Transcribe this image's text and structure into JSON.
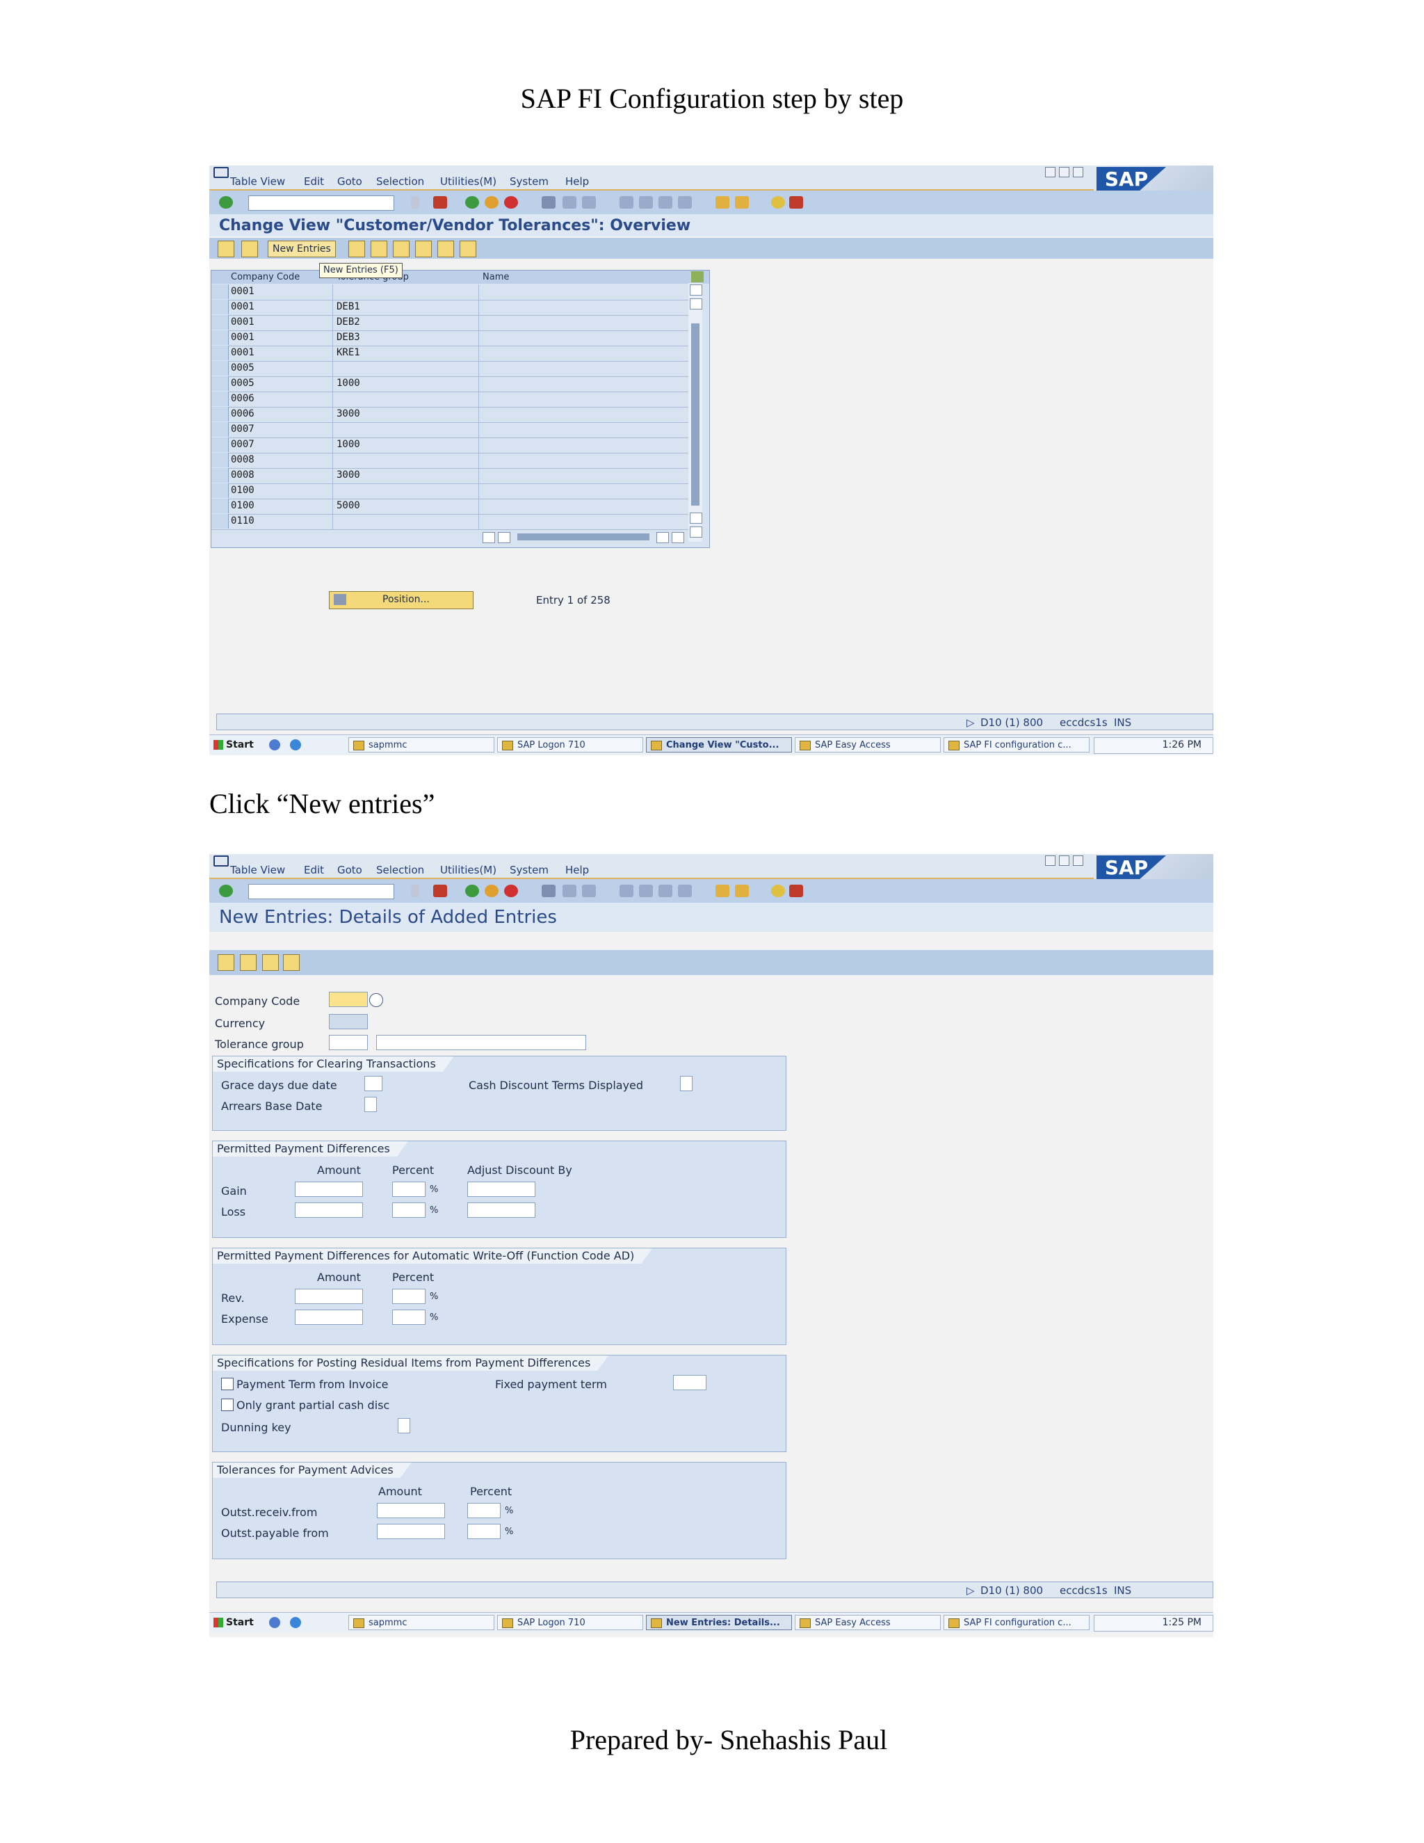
{
  "document": {
    "title": "SAP FI Configuration step by step",
    "caption": "Click “New entries”",
    "footer": "Prepared by- Snehashis Paul"
  },
  "colors": {
    "sap_blue": "#1f56a8",
    "toolbar_blue": "#bcd0ea",
    "title_blue": "#2b4a8a",
    "required_yellow": "#fbe38e"
  },
  "menu": [
    "Table View",
    "Edit",
    "Goto",
    "Selection",
    "Utilities(M)",
    "System",
    "Help"
  ],
  "sap_logo": "SAP",
  "screen1": {
    "title": "Change View \"Customer/Vendor Tolerances\": Overview",
    "new_entries_label": "New Entries",
    "tooltip": "New Entries   (F5)",
    "columns": [
      "Company Code",
      "Tolerance group",
      "Name"
    ],
    "rows": [
      [
        "0001",
        ""
      ],
      [
        "0001",
        "DEB1"
      ],
      [
        "0001",
        "DEB2"
      ],
      [
        "0001",
        "DEB3"
      ],
      [
        "0001",
        "KRE1"
      ],
      [
        "0005",
        ""
      ],
      [
        "0005",
        "1000"
      ],
      [
        "0006",
        ""
      ],
      [
        "0006",
        "3000"
      ],
      [
        "0007",
        ""
      ],
      [
        "0007",
        "1000"
      ],
      [
        "0008",
        ""
      ],
      [
        "0008",
        "3000"
      ],
      [
        "0100",
        ""
      ],
      [
        "0100",
        "5000"
      ],
      [
        "0110",
        ""
      ]
    ],
    "position_label": "Position...",
    "entry_info": "Entry 1 of 258",
    "status": {
      "system": "D10 (1) 800",
      "server": "eccdcs1s",
      "mode": "INS"
    },
    "taskbar": {
      "start": "Start",
      "tasks": [
        "sapmmc",
        "SAP Logon 710",
        "Change View \"Custo...",
        "SAP Easy Access",
        "SAP FI configuration c..."
      ],
      "active_index": 2,
      "clock": "1:26 PM"
    }
  },
  "screen2": {
    "title": "New Entries: Details of Added Entries",
    "fields": {
      "company_code": "Company Code",
      "currency": "Currency",
      "tolerance_group": "Tolerance group"
    },
    "clearing": {
      "title": "Specifications for Clearing Transactions",
      "grace_days": "Grace days due date",
      "arrears_base": "Arrears Base Date",
      "cash_discount": "Cash Discount Terms Displayed"
    },
    "payment_diff": {
      "title": "Permitted Payment Differences",
      "col_amount": "Amount",
      "col_percent": "Percent",
      "col_adjust": "Adjust Discount By",
      "gain": "Gain",
      "loss": "Loss"
    },
    "auto_writeoff": {
      "title": "Permitted Payment Differences for Automatic Write-Off (Function Code AD)",
      "col_amount": "Amount",
      "col_percent": "Percent",
      "rev": "Rev.",
      "expense": "Expense"
    },
    "residual": {
      "title": "Specifications for Posting Residual Items from Payment Differences",
      "payment_term": "Payment Term from Invoice",
      "partial_cash": "Only grant partial cash disc",
      "dunning_key": "Dunning key",
      "fixed_term": "Fixed payment term"
    },
    "advices": {
      "title": "Tolerances for Payment Advices",
      "col_amount": "Amount",
      "col_percent": "Percent",
      "outst_receiv": "Outst.receiv.from",
      "outst_payable": "Outst.payable from"
    },
    "percent_sign": "%",
    "status": {
      "system": "D10 (1) 800",
      "server": "eccdcs1s",
      "mode": "INS"
    },
    "taskbar": {
      "start": "Start",
      "tasks": [
        "sapmmc",
        "SAP Logon 710",
        "New Entries: Details...",
        "SAP Easy Access",
        "SAP FI configuration c..."
      ],
      "active_index": 2,
      "clock": "1:25 PM"
    }
  }
}
